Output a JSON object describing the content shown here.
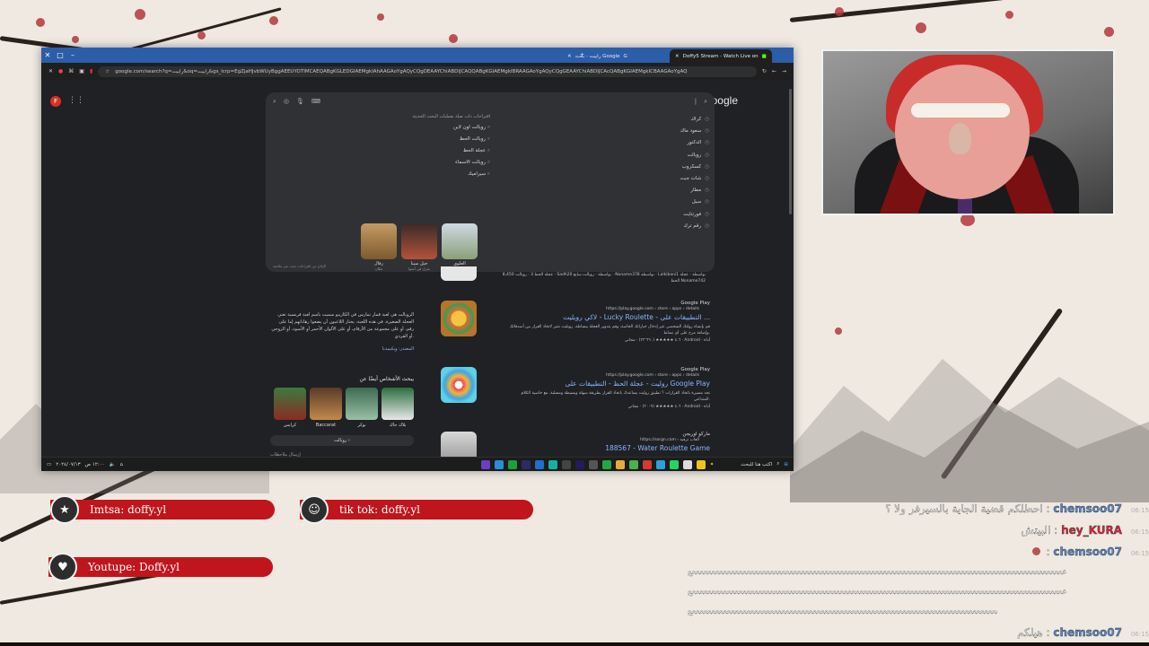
{
  "browser": {
    "tabs": [
      {
        "label": "رابيت - بحث Google",
        "active": true
      },
      {
        "label": "Doffy5 Stream - Watch Live on",
        "active": false
      }
    ],
    "url": "google.com/search?q=رابيت&oq=رابيت&gs_lcrp=EgZjaHJvbWUyBggAEEUYOTIMCAEQABgKGLEDGIAEMgkIAhAAGAoYgAQyCQgDEAAYChiABDIJCAQQABgKGIAEMgkIBRAAGAoYgAQyCQgGEAAYChiABDIJCAcQABgKGIAEMgkICBAAGAoYgAQ"
  },
  "google": {
    "logo": "Google",
    "avatar_letter": "F",
    "suggestions_right": [
      "كراك",
      "سعود ماك",
      "الدكتور",
      "رويالت",
      "كسكروب",
      "شات جبت",
      "مطار",
      "سيل",
      "فورتنايت",
      "رقم ترك"
    ],
    "suggestions_head": "اقتراحات ذات صلة بعمليات البحث الحديثة",
    "suggestions_mid": [
      "رويالت اون لاين",
      "رويالت الحظ",
      "عجلة الحظ",
      "رويالت الاسماء",
      "سيراميك"
    ],
    "thumbnails": [
      {
        "title": "العلوي",
        "sub": "مدينة في المغرب"
      },
      {
        "title": "جبل سينا",
        "sub": "منزل في أسوا"
      },
      {
        "title": "رفال",
        "sub": "مكان"
      }
    ],
    "drop_footer": "الإبلاغ عن اقتراحات بحث غير ملائمة",
    "results": [
      {
        "source": "Google Play",
        "url": "https://play.google.com › store › apps › details",
        "title": "لاكي رويليت - Lucky Roulette - التطبيقات على ...",
        "desc": "قم بإنشاء رولتك الشخصي عبر إدخال خياراتك الخاصة، وقم بتدوير العجلة ببساطة. رويليت مثير لاتخاذ القرار بين أصدقائك وإضافة مرح على أي نشاط.",
        "stars": "٤.٦ ★★★★★ (٣٣٬٦٦٠) · مجاني · Android · أداة"
      },
      {
        "source": "Google Play",
        "url": "https://play.google.com › store › apps › details",
        "title": "روليت - عجلة الحظ - التطبيقات على Google Play",
        "desc": "تجد مسيرة باتخاذ القرارات ؟ تطبيق روليت يساعدك باتخاذ القرار بطريقة سهلة وبسيطة ومسلية. مع خاصية الكلام المتداعي.",
        "stars": "٤.٦ ★★★★★ (٣٠٠٩) · مجاني · Android · أداة"
      },
      {
        "source": "ماركو أوريجن",
        "url": "https://sorgn.com › العاب ترفيه",
        "title": "188567 - Water Roulette Game",
        "desc": "",
        "stars": ""
      }
    ],
    "result_top_text": "8,450 عجلة الحظ 3 · رويالت · Sadh20 بواسطة · رويالت سابع · Noname378 بواسطة · Lalkibani1 بواسطة · عجلة الحظ Noname742",
    "left_text": "الرويالت هي لعبة قمار تمارس في الكازينو سميت باسم لعبة فرنسية تعني العجلة الصغيرة. في هذه اللعبة، يختار اللاعبون أن يضعوا رهاناتهم إما على رقم، أو على مجموعة من الأرقام، أو على الألوان الأحمر أو الأسود، أو الزوجي أو الفردي.",
    "left_more": "المصدر: ويكيبيديا",
    "people_title": "يبحث الأشخاص أيضًا عن",
    "people": [
      "بلاك جاك",
      "بوكر",
      "Baccarat",
      "كرابس"
    ],
    "more_button": "رويالت ›",
    "feedback": "إرسال ملاحظات"
  },
  "taskbar": {
    "search": "اكتب هنا للبحث",
    "time": "١٢:٠٠ ص",
    "date": "٢٠٢٤/٠٧/١٣"
  },
  "socials": [
    {
      "label": "Imtsa: doffy.yl"
    },
    {
      "label": "tik tok: doffy.yl"
    },
    {
      "label": "Youtupe: Doffy.yl"
    }
  ],
  "chat": [
    {
      "time": "06:15",
      "user": "chemsoo07",
      "text": ": احطلكم قضية الجاية بالسيرفر ولا ؟"
    },
    {
      "time": "06:15",
      "user": "hey_KURA",
      "text": ": البيتش"
    },
    {
      "time": "06:15",
      "user": "chemsoo07",
      "text": ":"
    },
    {
      "time": "06:15",
      "user": "chemsoo07",
      "text": ": هيلكم"
    }
  ],
  "chat_spam": "ععععععععععععععععععععععععععععععععععععععععععععععععععععععععععععععععععععععععععععععععععععععععععععععععع",
  "colors": {
    "accent": "#c0151c",
    "chemsoo07": "#5b86c9",
    "hey_KURA": "#d8263a",
    "link": "#8ab4f8",
    "window_titlebar": "#2b5ea8"
  }
}
